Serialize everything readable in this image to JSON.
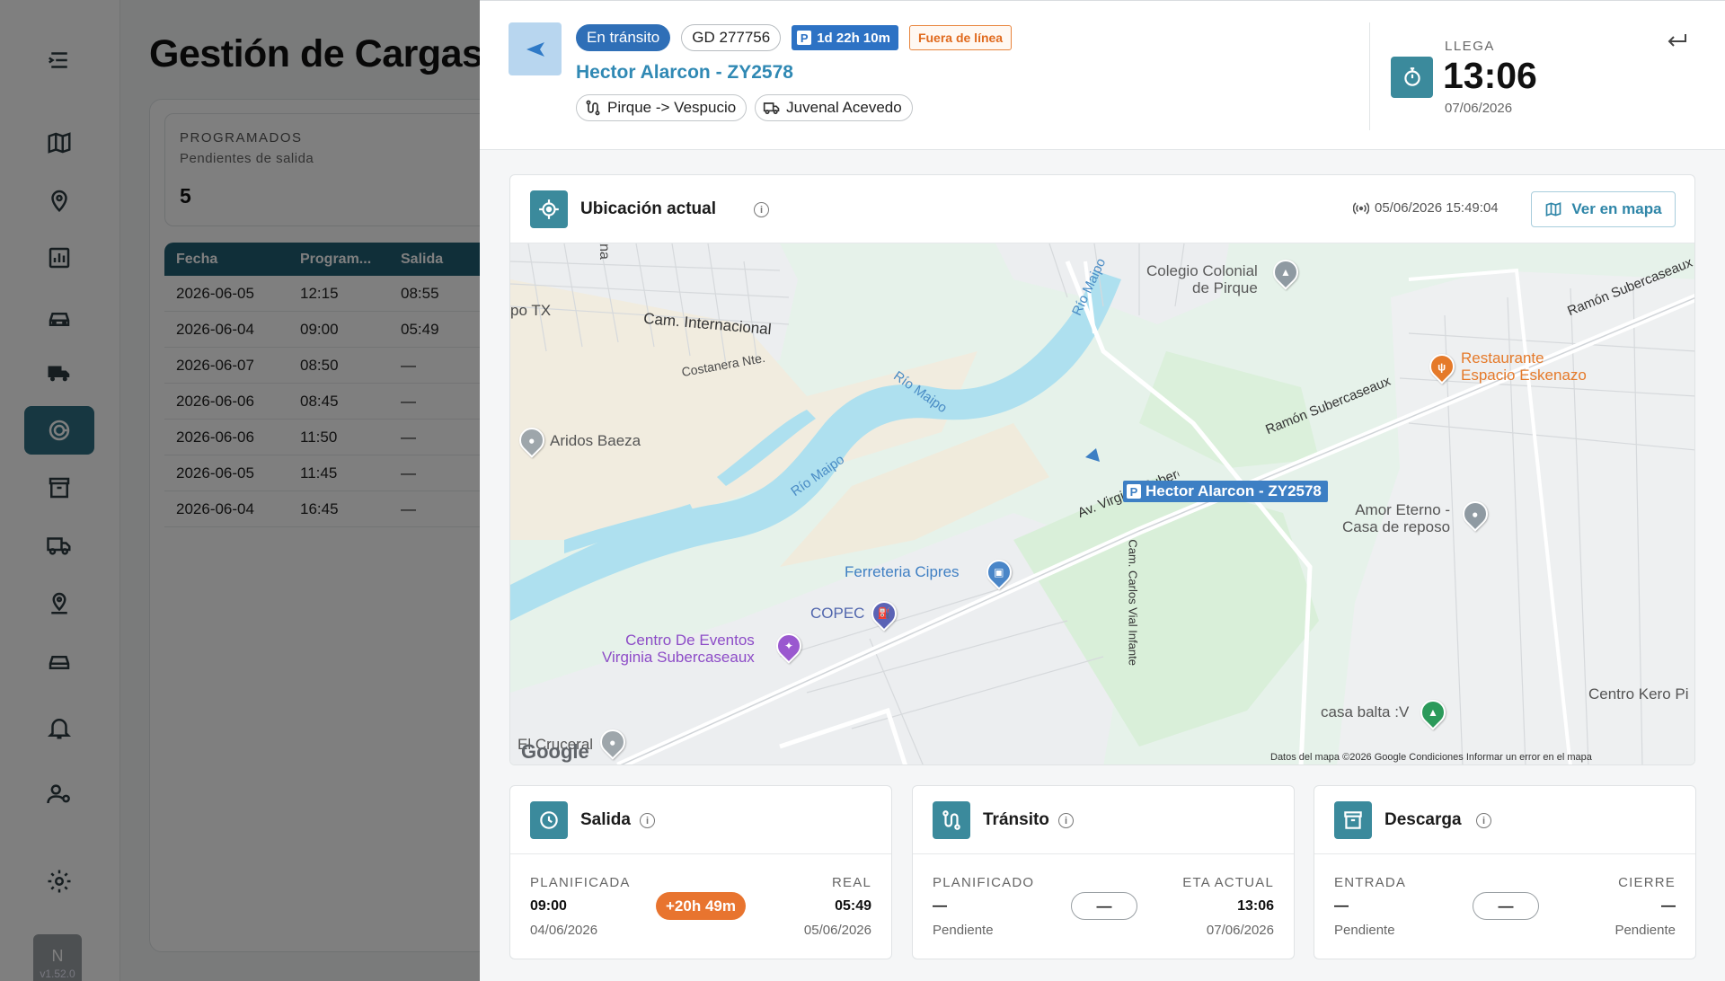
{
  "app": {
    "page_title": "Gestión de Cargas",
    "version": "v1.52.0",
    "user_initial": "N",
    "programados": {
      "label": "PROGRAMADOS",
      "sub": "Pendientes de salida",
      "count": "5"
    },
    "table": {
      "headers": [
        "Fecha",
        "Program...",
        "Salida"
      ],
      "rows": [
        [
          "2026-06-05",
          "12:15",
          "08:55"
        ],
        [
          "2026-06-04",
          "09:00",
          "05:49"
        ],
        [
          "2026-06-07",
          "08:50",
          "—"
        ],
        [
          "2026-06-06",
          "08:45",
          "—"
        ],
        [
          "2026-06-06",
          "11:50",
          "—"
        ],
        [
          "2026-06-05",
          "11:45",
          "—"
        ],
        [
          "2026-06-04",
          "16:45",
          "—"
        ]
      ]
    },
    "sidebar_icons": [
      "menu-icon",
      "map-icon",
      "location-pin-icon",
      "chart-icon",
      "car-icon",
      "truck-icon",
      "target-icon",
      "archive-icon",
      "delivery-truck-icon",
      "place-icon",
      "car-icon",
      "bell-icon",
      "user-settings-icon",
      "gear-icon"
    ]
  },
  "drawer": {
    "status": "En tránsito",
    "gd": "GD 277756",
    "duration": "1d 22h 10m",
    "offline": "Fuera de línea",
    "driver": "Hector Alarcon - ZY2578",
    "route": "Pirque -> Vespucio",
    "carrier": "Juvenal Acevedo",
    "eta": {
      "label": "LLEGA",
      "time": "13:06",
      "date": "07/06/2026"
    }
  },
  "location": {
    "title": "Ubicación actual",
    "timestamp": "05/06/2026 15:49:04",
    "map_button": "Ver en mapa",
    "map": {
      "labels": {
        "colegio": "Colegio Colonial\nde Pirque",
        "po_tx": "po TX",
        "cam_internacional": "Cam. Internacional",
        "costanera": "Costanera Nte.",
        "rio_maipo_1": "Río Maipo",
        "rio_maipo_2": "Río Maipo",
        "rio_maipo_3": "Río Maipo",
        "ramon_1": "Ramón Subercaseaux",
        "ramon_2": "Ramón Subercaseaux",
        "av_virginia": "Av. Virginia Subercaseaux",
        "cam_carlos": "Cam. Carlos Vial Infante",
        "na": "na"
      },
      "pois": {
        "restaurante": "Restaurante\nEspacio Eskenazo",
        "aridos": "Aridos Baeza",
        "ferreteria": "Ferreteria Cipres",
        "copec": "COPEC",
        "centro_eventos": "Centro De Eventos\nVirginia Subercaseaux",
        "amor_eterno": "Amor Eterno -\nCasa de reposo",
        "el_cruceral": "El Cruceral",
        "casa_balta": "casa balta :V",
        "centro_kero": "Centro Kero Pi"
      },
      "vehicle_label": "Hector Alarcon - ZY2578",
      "google": "Google",
      "attribution": "Datos del mapa ©2026 Google    Condiciones    Informar un error en el mapa"
    }
  },
  "stages": {
    "salida": {
      "title": "Salida",
      "left_label": "PLANIFICADA",
      "left_value": "09:00",
      "left_sub": "04/06/2026",
      "badge": "+20h 49m",
      "right_label": "REAL",
      "right_value": "05:49",
      "right_sub": "05/06/2026"
    },
    "transito": {
      "title": "Tránsito",
      "left_label": "PLANIFICADO",
      "left_value": "—",
      "left_sub": "Pendiente",
      "badge": "—",
      "right_label": "ETA ACTUAL",
      "right_value": "13:06",
      "right_sub": "07/06/2026"
    },
    "descarga": {
      "title": "Descarga",
      "left_label": "ENTRADA",
      "left_value": "—",
      "left_sub": "Pendiente",
      "badge": "—",
      "right_label": "CIERRE",
      "right_value": "—",
      "right_sub": "Pendiente"
    }
  },
  "colors": {
    "accent": "#3b8a9c",
    "status_blue": "#2f6fb7",
    "warning": "#e8742f",
    "link": "#3089b4"
  }
}
